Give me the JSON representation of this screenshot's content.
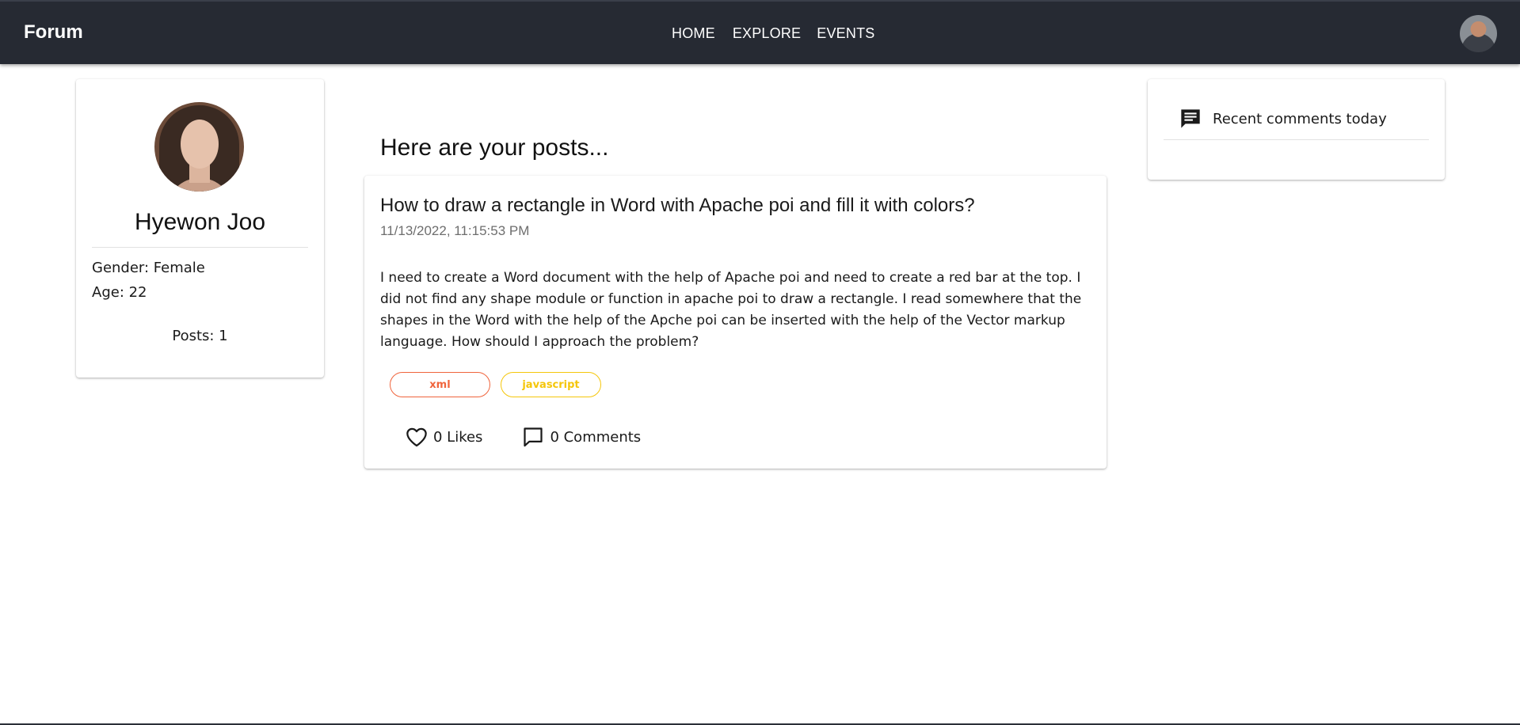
{
  "navbar": {
    "brand": "Forum",
    "links": [
      "HOME",
      "EXPLORE",
      "EVENTS"
    ],
    "background": "#262a33"
  },
  "profile": {
    "name": "Hyewon Joo",
    "gender": "Gender: Female",
    "age": "Age: 22",
    "posts": "Posts: 1"
  },
  "posts_heading": "Here are your posts...",
  "post": {
    "title": "How to draw a rectangle in Word with Apache poi and fill it with colors?",
    "date": "11/13/2022, 11:15:53 PM",
    "body": "I need to create a Word document with the help of Apache poi and need to create a red bar at the top. I did not find any shape module or function in apache poi to draw a rectangle. I read somewhere that the shapes in the Word with the help of the Apche poi can be inserted with the help of the Vector markup language. How should I approach the problem?",
    "tags": [
      {
        "label": "xml",
        "color": "#f0643c"
      },
      {
        "label": "javascript",
        "color": "#f5c60a"
      }
    ],
    "likes": "0 Likes",
    "comments": "0 Comments"
  },
  "recent": {
    "title": "Recent comments today",
    "icon": "comment-icon"
  }
}
